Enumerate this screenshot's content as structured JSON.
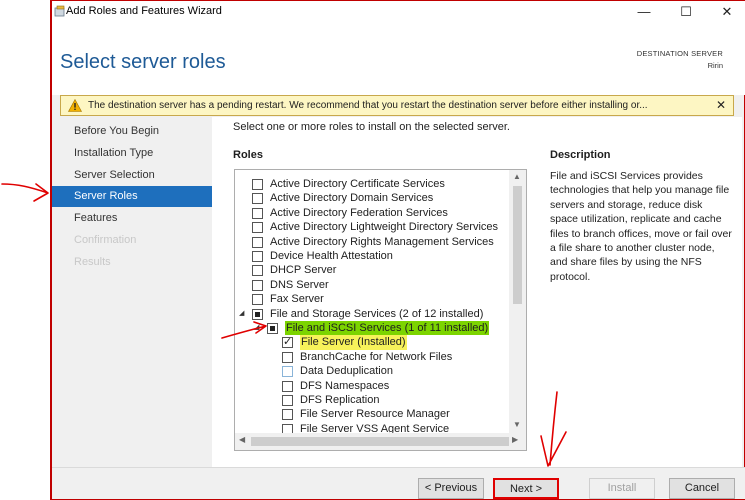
{
  "window": {
    "title": "Add Roles and Features Wizard",
    "controls": {
      "minimize": "—",
      "maximize": "☐",
      "close": "✕"
    }
  },
  "header": {
    "page_title": "Select server roles",
    "destination_label": "DESTINATION SERVER",
    "destination_name": "Ririn"
  },
  "warning": {
    "text": "The destination server has a pending restart. We recommend that you restart the destination server before either installing or...",
    "close": "✕",
    "icon": "warning-icon"
  },
  "sidebar": {
    "items": [
      {
        "label": "Before You Begin",
        "state": "normal"
      },
      {
        "label": "Installation Type",
        "state": "normal"
      },
      {
        "label": "Server Selection",
        "state": "normal"
      },
      {
        "label": "Server Roles",
        "state": "active"
      },
      {
        "label": "Features",
        "state": "normal"
      },
      {
        "label": "Confirmation",
        "state": "disabled"
      },
      {
        "label": "Results",
        "state": "disabled"
      }
    ]
  },
  "main": {
    "instruction": "Select one or more roles to install on the selected server.",
    "roles_heading": "Roles",
    "description_heading": "Description",
    "description": "File and iSCSI Services provides technologies that help you manage file servers and storage, reduce disk space utilization, replicate and cache files to branch offices, move or fail over a file share to another cluster node, and share files by using the NFS protocol.",
    "roles": [
      {
        "label": "Active Directory Certificate Services",
        "check": "none"
      },
      {
        "label": "Active Directory Domain Services",
        "check": "none"
      },
      {
        "label": "Active Directory Federation Services",
        "check": "none"
      },
      {
        "label": "Active Directory Lightweight Directory Services",
        "check": "none"
      },
      {
        "label": "Active Directory Rights Management Services",
        "check": "none"
      },
      {
        "label": "Device Health Attestation",
        "check": "none"
      },
      {
        "label": "DHCP Server",
        "check": "none"
      },
      {
        "label": "DNS Server",
        "check": "none"
      },
      {
        "label": "Fax Server",
        "check": "none"
      },
      {
        "label": "File and Storage Services (2 of 12 installed)",
        "check": "partial",
        "expander": "◢"
      },
      {
        "label": "File and iSCSI Services (1 of 11 installed)",
        "check": "partial",
        "expander": "◢"
      },
      {
        "label": "File Server (Installed)",
        "check": "checked"
      },
      {
        "label": "BranchCache for Network Files",
        "check": "none"
      },
      {
        "label": "Data Deduplication",
        "check": "none"
      },
      {
        "label": "DFS Namespaces",
        "check": "none"
      },
      {
        "label": "DFS Replication",
        "check": "none"
      },
      {
        "label": "File Server Resource Manager",
        "check": "none"
      },
      {
        "label": "File Server VSS Agent Service",
        "check": "none"
      }
    ]
  },
  "footer": {
    "previous": "< Previous",
    "next": "Next >",
    "install": "Install",
    "cancel": "Cancel"
  },
  "colors": {
    "accent": "#1e6fbd",
    "title_blue": "#1e5a96",
    "warning_bg": "#fdf6c3",
    "highlight_green": "#7cd400",
    "highlight_yellow": "#f7f25a",
    "annotation_red": "#e00000"
  }
}
